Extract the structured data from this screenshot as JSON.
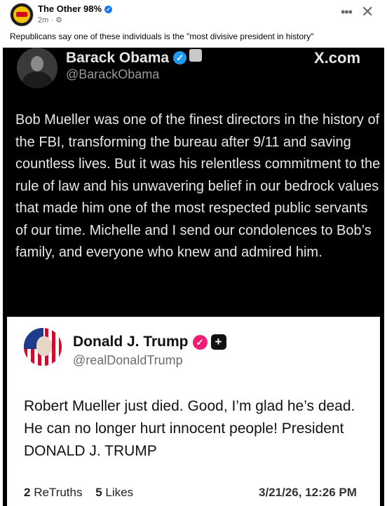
{
  "post": {
    "page_name": "The Other 98%",
    "timestamp": "2m",
    "privacy_icon": "gear-icon",
    "caption": "Republicans say one of these individuals is the \"most divisive president in history\""
  },
  "obama_tweet": {
    "name": "Barack Obama",
    "handle": "@BarackObama",
    "source": "X.com",
    "text": "Bob Mueller was one of the finest directors in the history of the FBI, transforming the bureau after 9/11 and saving countless lives. But it was his relentless commitment to the rule of law and his unwavering belief in our bedrock values that made him one of the most respected public servants of our time. Michelle and I send our condolences to Bob’s family, and everyone who knew and admired him."
  },
  "trump_truth": {
    "name": "Donald J. Trump",
    "handle": "@realDonaldTrump",
    "text": "Robert Mueller just died. Good, I’m glad he’s dead. He can no longer hurt innocent people! President DONALD J. TRUMP",
    "retruths_count": "2",
    "retruths_label": "ReTruths",
    "likes_count": "5",
    "likes_label": "Likes",
    "date": "3/21/26, 12:26 PM"
  },
  "colors": {
    "facebook_blue": "#1877f2",
    "x_verified": "#1d9bf0",
    "truth_pink": "#f01d77"
  }
}
